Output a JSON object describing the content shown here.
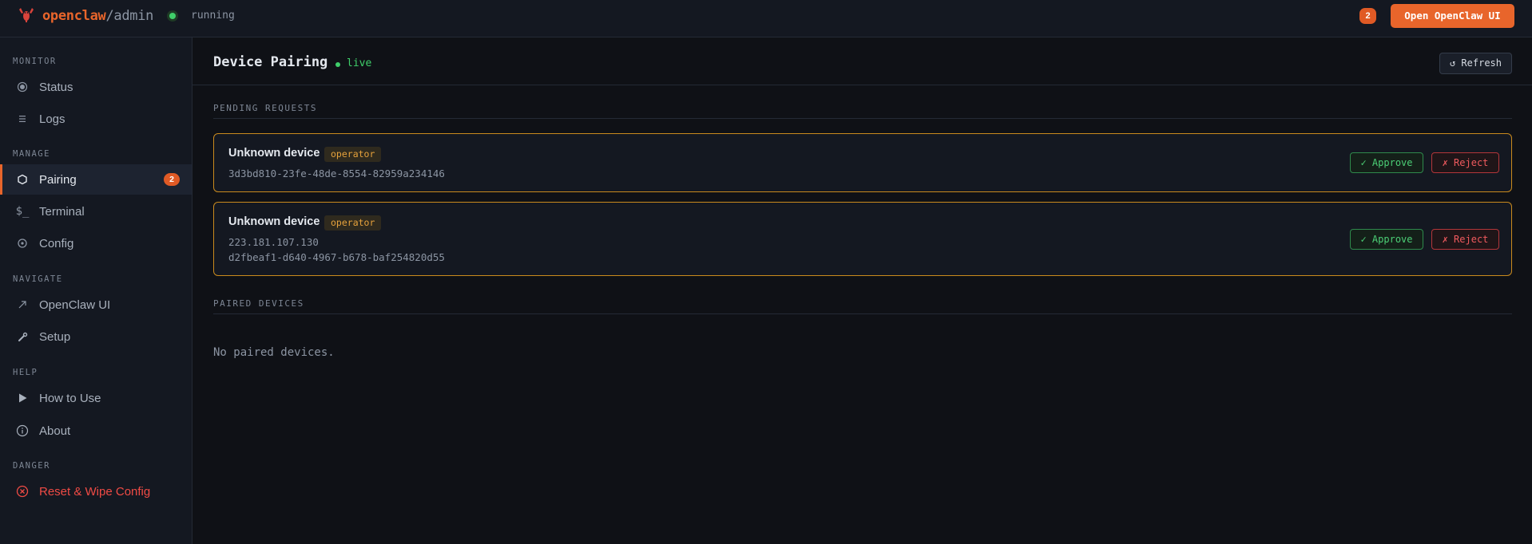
{
  "topbar": {
    "brand_name": "openclaw",
    "brand_sub": "/admin",
    "status": "running",
    "notification_count": "2",
    "open_button": "Open OpenClaw UI"
  },
  "sidebar": {
    "sections": [
      {
        "label": "MONITOR"
      },
      {
        "label": "MANAGE"
      },
      {
        "label": "NAVIGATE"
      },
      {
        "label": "HELP"
      },
      {
        "label": "DANGER"
      }
    ],
    "items": [
      {
        "label": "Status",
        "icon": "radio-dot-icon"
      },
      {
        "label": "Logs",
        "icon": "list-icon"
      },
      {
        "label": "Pairing",
        "icon": "hexagon-icon",
        "badge": "2",
        "active": true
      },
      {
        "label": "Terminal",
        "icon": "terminal-icon",
        "glyph": "$_"
      },
      {
        "label": "Config",
        "icon": "gear-icon"
      },
      {
        "label": "OpenClaw UI",
        "icon": "external-arrow-icon"
      },
      {
        "label": "Setup",
        "icon": "wrench-icon"
      },
      {
        "label": "How to Use",
        "icon": "play-icon"
      },
      {
        "label": "About",
        "icon": "info-icon"
      },
      {
        "label": "Reset & Wipe Config",
        "icon": "circle-x-icon"
      }
    ]
  },
  "main": {
    "title": "Device Pairing",
    "live_label": "live",
    "refresh_button": "↺ Refresh",
    "pending_heading": "PENDING REQUESTS",
    "pending": [
      {
        "name": "Unknown device",
        "role": "operator",
        "lines": [
          "3d3bd810-23fe-48de-8554-82959a234146"
        ],
        "approve": "✓ Approve",
        "reject": "✗ Reject"
      },
      {
        "name": "Unknown device",
        "role": "operator",
        "lines": [
          "223.181.107.130",
          "d2fbeaf1-d640-4967-b678-baf254820d55"
        ],
        "approve": "✓ Approve",
        "reject": "✗ Reject"
      }
    ],
    "paired_heading": "PAIRED DEVICES",
    "paired_empty": "No paired devices."
  },
  "colors": {
    "accent": "#e8652b",
    "approve": "#4ccf76",
    "reject": "#f05a5e",
    "pending_border": "#c98a1d",
    "live": "#3fcf6a"
  }
}
